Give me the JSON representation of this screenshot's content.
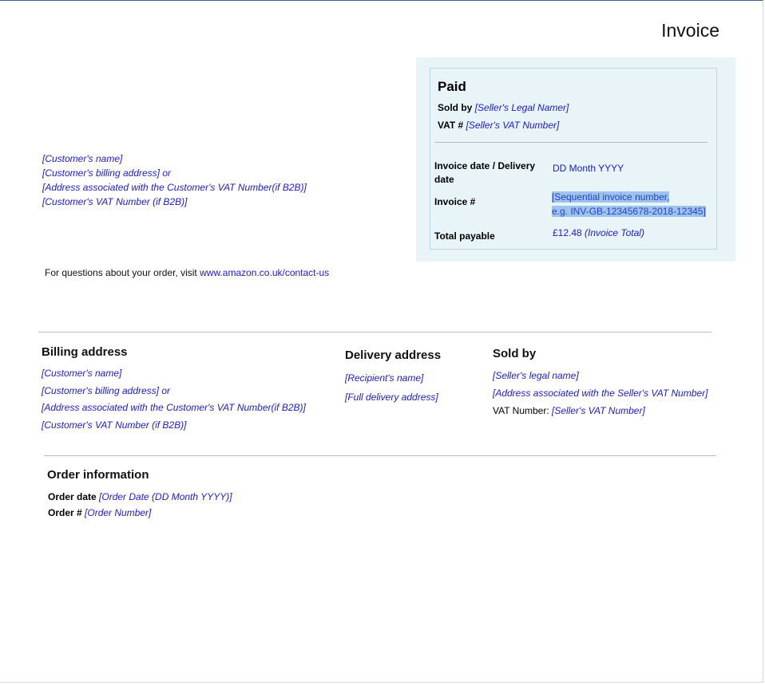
{
  "header": {
    "title": "Invoice"
  },
  "paid_box": {
    "status": "Paid",
    "sold_by_label": "Sold by",
    "sold_by_value": "[Seller's Legal Namer]",
    "vat_label": "VAT #",
    "vat_value": "[Seller's VAT Number]",
    "invoice_date_label": "Invoice date / Delivery date",
    "invoice_date_value": "DD Month YYYY",
    "invoice_number_label": "Invoice #",
    "invoice_number_line1": "[Sequential invoice number,",
    "invoice_number_line2": "e.g. INV-GB-12345678-2018-12345]",
    "total_label": "Total payable",
    "total_amount": "£12.48",
    "total_note": "(Invoice Total)"
  },
  "customer_block": {
    "lines": [
      "[Customer's name]",
      "[Customer's billing address] or",
      "[Address associated with the Customer's VAT Number(if B2B)]",
      "[Customer's VAT Number (if B2B)]"
    ]
  },
  "questions": {
    "text": "For questions about your order, visit ",
    "link": "www.amazon.co.uk/contact-us"
  },
  "billing": {
    "heading": "Billing address",
    "lines": [
      "[Customer's name]",
      "[Customer's billing address] or",
      "[Address associated with the Customer's VAT Number(if B2B)]",
      "[Customer's VAT Number (if B2B)]"
    ]
  },
  "delivery": {
    "heading": "Delivery address",
    "lines": [
      "[Recipient's name]",
      "[Full delivery address]"
    ]
  },
  "sold_by": {
    "heading": "Sold by",
    "lines": [
      "[Seller's legal name]",
      "[Address associated with the Seller's VAT Number]"
    ],
    "vat_label": "VAT Number:",
    "vat_value": "[Seller's VAT Number]"
  },
  "order": {
    "heading": "Order information",
    "date_label": "Order date",
    "date_value": "[Order Date (DD Month YYYY)]",
    "number_label": "Order #",
    "number_value": "[Order Number]"
  },
  "colors": {
    "placeholder_text": "#1a1ad6",
    "paid_box_bg": "#e8f4f8",
    "highlight": "#9ec3ec",
    "top_border": "#3a5f8a"
  }
}
